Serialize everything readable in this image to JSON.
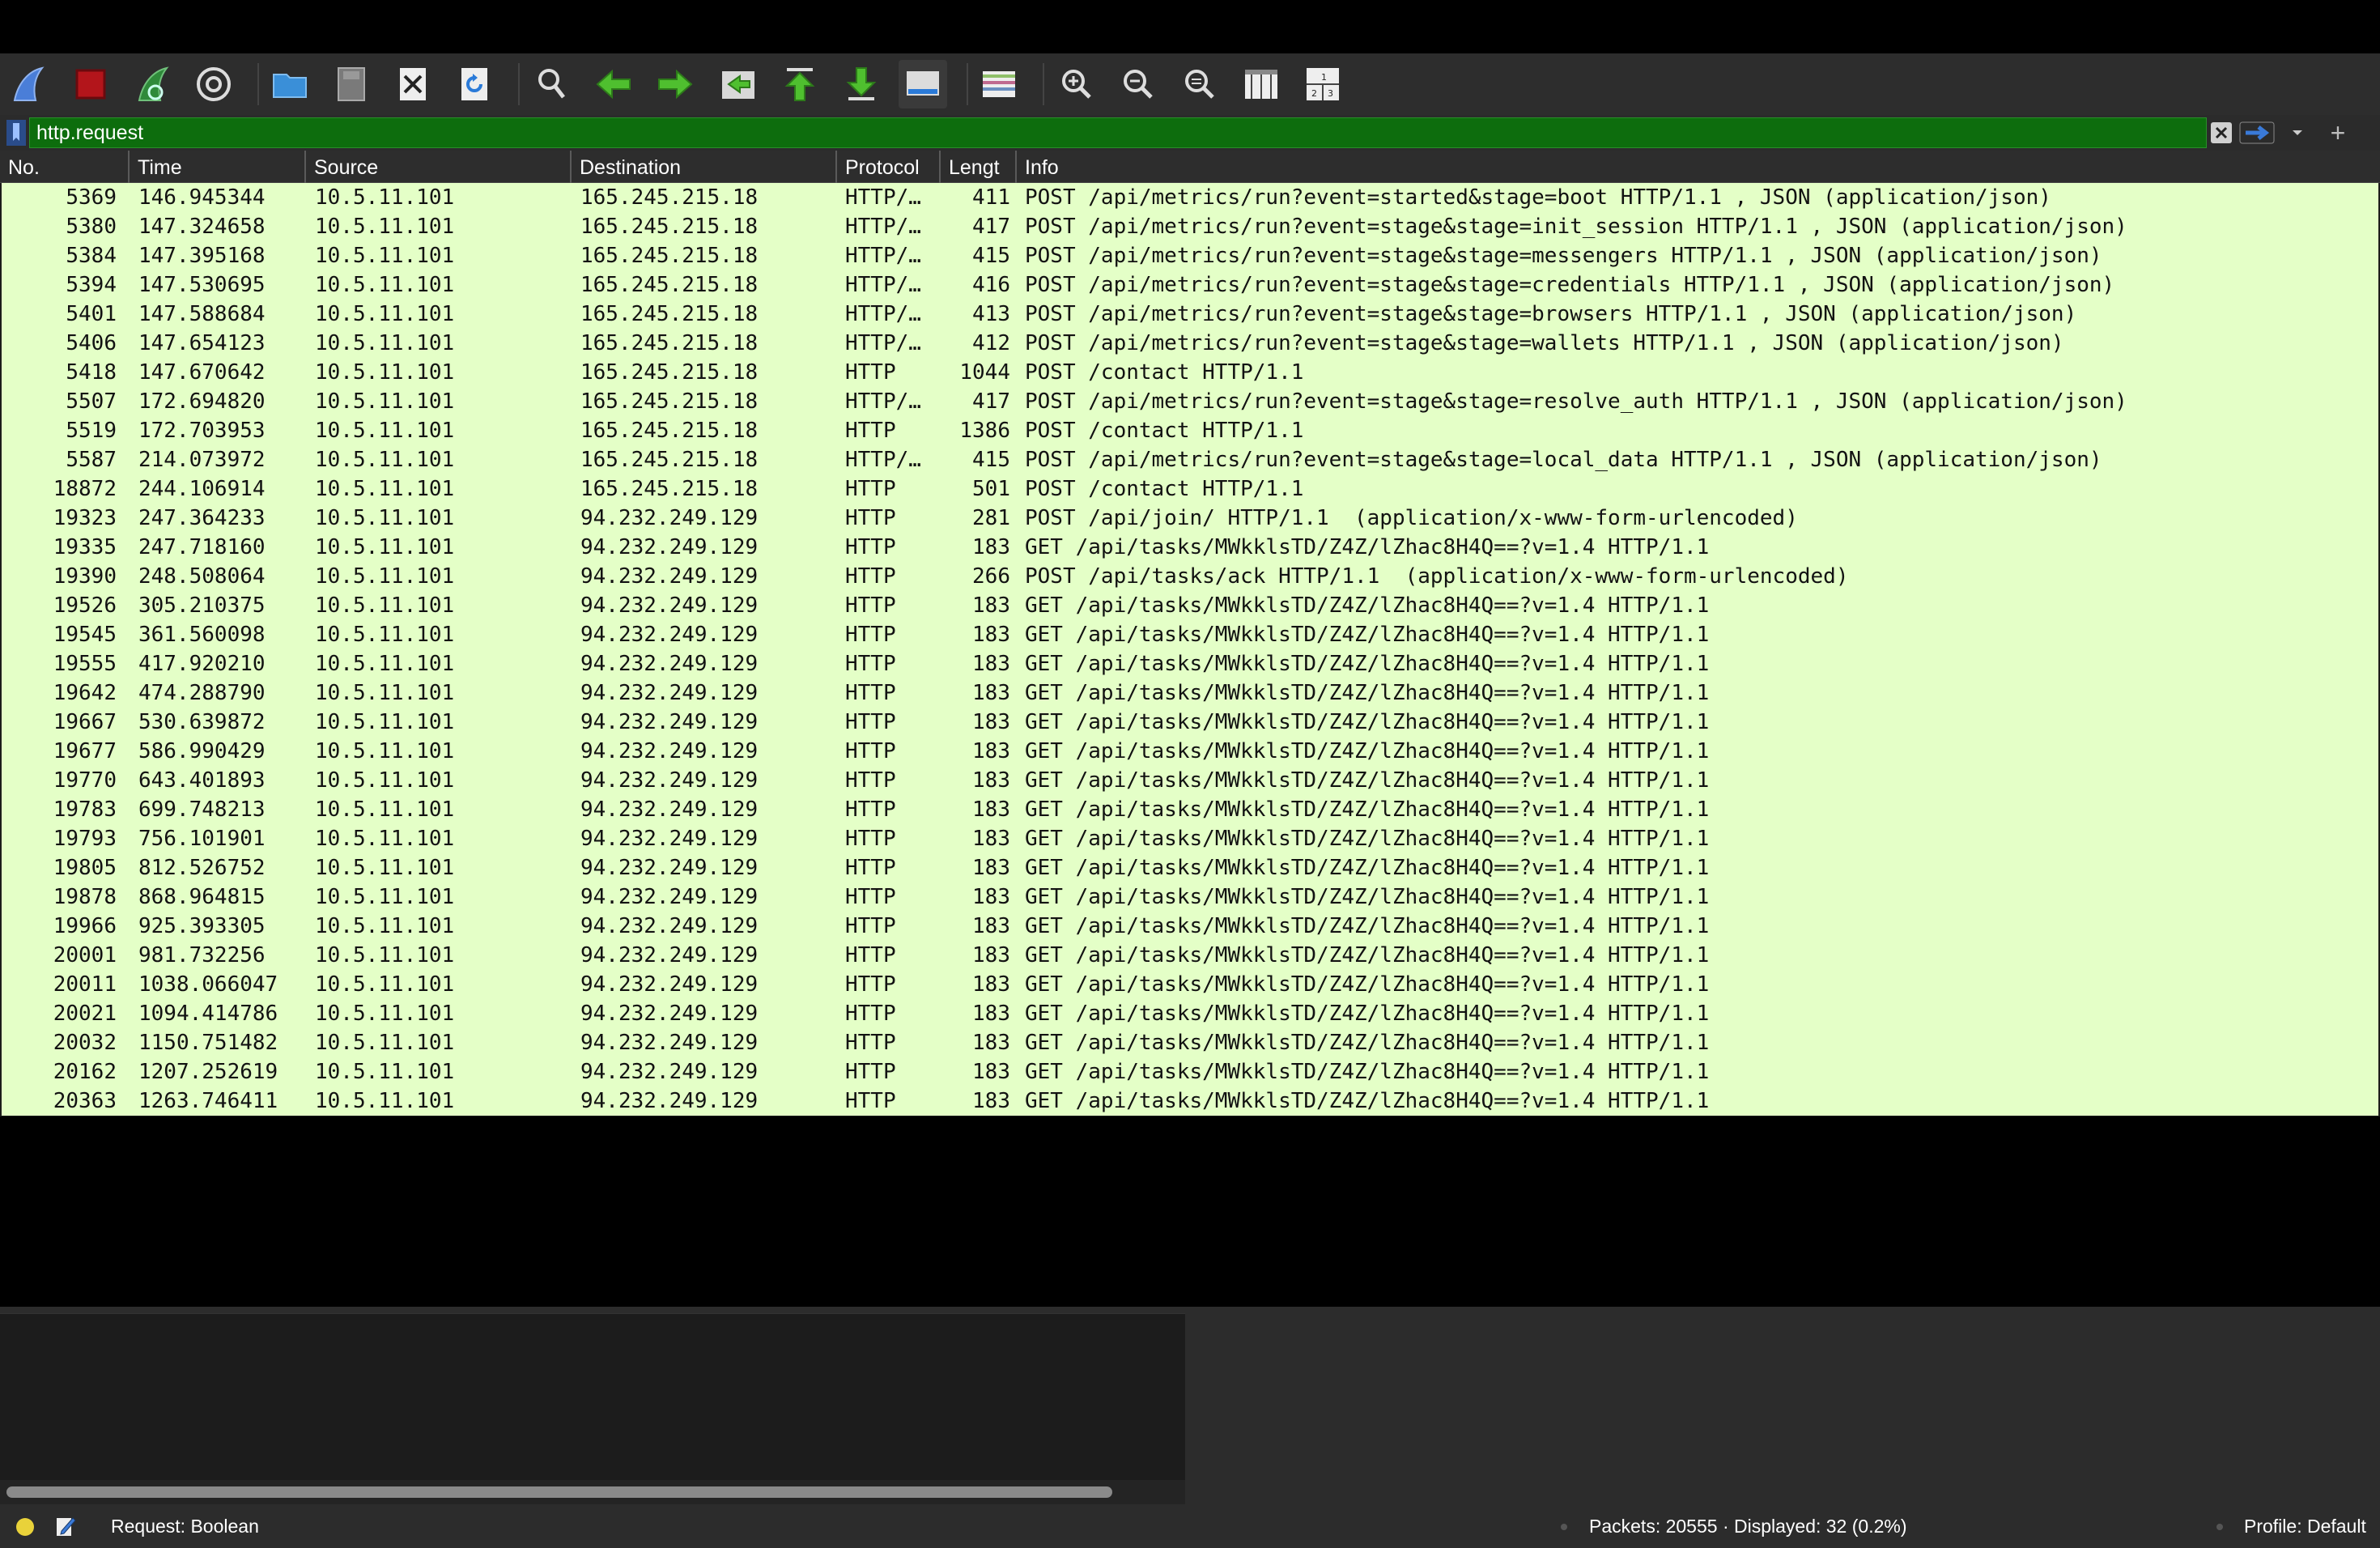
{
  "filter": {
    "value": "http.request"
  },
  "columns": {
    "no": "No.",
    "time": "Time",
    "source": "Source",
    "destination": "Destination",
    "protocol": "Protocol",
    "length": "Lengt",
    "info": "Info"
  },
  "packets": [
    {
      "no": "5369",
      "time": "146.945344",
      "src": "10.5.11.101",
      "dst": "165.245.215.18",
      "proto": "HTTP/…",
      "len": "411",
      "info": "POST /api/metrics/run?event=started&stage=boot HTTP/1.1 , JSON (application/json)"
    },
    {
      "no": "5380",
      "time": "147.324658",
      "src": "10.5.11.101",
      "dst": "165.245.215.18",
      "proto": "HTTP/…",
      "len": "417",
      "info": "POST /api/metrics/run?event=stage&stage=init_session HTTP/1.1 , JSON (application/json)"
    },
    {
      "no": "5384",
      "time": "147.395168",
      "src": "10.5.11.101",
      "dst": "165.245.215.18",
      "proto": "HTTP/…",
      "len": "415",
      "info": "POST /api/metrics/run?event=stage&stage=messengers HTTP/1.1 , JSON (application/json)"
    },
    {
      "no": "5394",
      "time": "147.530695",
      "src": "10.5.11.101",
      "dst": "165.245.215.18",
      "proto": "HTTP/…",
      "len": "416",
      "info": "POST /api/metrics/run?event=stage&stage=credentials HTTP/1.1 , JSON (application/json)"
    },
    {
      "no": "5401",
      "time": "147.588684",
      "src": "10.5.11.101",
      "dst": "165.245.215.18",
      "proto": "HTTP/…",
      "len": "413",
      "info": "POST /api/metrics/run?event=stage&stage=browsers HTTP/1.1 , JSON (application/json)"
    },
    {
      "no": "5406",
      "time": "147.654123",
      "src": "10.5.11.101",
      "dst": "165.245.215.18",
      "proto": "HTTP/…",
      "len": "412",
      "info": "POST /api/metrics/run?event=stage&stage=wallets HTTP/1.1 , JSON (application/json)"
    },
    {
      "no": "5418",
      "time": "147.670642",
      "src": "10.5.11.101",
      "dst": "165.245.215.18",
      "proto": "HTTP",
      "len": "1044",
      "info": "POST /contact HTTP/1.1"
    },
    {
      "no": "5507",
      "time": "172.694820",
      "src": "10.5.11.101",
      "dst": "165.245.215.18",
      "proto": "HTTP/…",
      "len": "417",
      "info": "POST /api/metrics/run?event=stage&stage=resolve_auth HTTP/1.1 , JSON (application/json)"
    },
    {
      "no": "5519",
      "time": "172.703953",
      "src": "10.5.11.101",
      "dst": "165.245.215.18",
      "proto": "HTTP",
      "len": "1386",
      "info": "POST /contact HTTP/1.1"
    },
    {
      "no": "5587",
      "time": "214.073972",
      "src": "10.5.11.101",
      "dst": "165.245.215.18",
      "proto": "HTTP/…",
      "len": "415",
      "info": "POST /api/metrics/run?event=stage&stage=local_data HTTP/1.1 , JSON (application/json)"
    },
    {
      "no": "18872",
      "time": "244.106914",
      "src": "10.5.11.101",
      "dst": "165.245.215.18",
      "proto": "HTTP",
      "len": "501",
      "info": "POST /contact HTTP/1.1"
    },
    {
      "no": "19323",
      "time": "247.364233",
      "src": "10.5.11.101",
      "dst": "94.232.249.129",
      "proto": "HTTP",
      "len": "281",
      "info": "POST /api/join/ HTTP/1.1  (application/x-www-form-urlencoded)"
    },
    {
      "no": "19335",
      "time": "247.718160",
      "src": "10.5.11.101",
      "dst": "94.232.249.129",
      "proto": "HTTP",
      "len": "183",
      "info": "GET /api/tasks/MWkklsTD/Z4Z/lZhac8H4Q==?v=1.4 HTTP/1.1"
    },
    {
      "no": "19390",
      "time": "248.508064",
      "src": "10.5.11.101",
      "dst": "94.232.249.129",
      "proto": "HTTP",
      "len": "266",
      "info": "POST /api/tasks/ack HTTP/1.1  (application/x-www-form-urlencoded)"
    },
    {
      "no": "19526",
      "time": "305.210375",
      "src": "10.5.11.101",
      "dst": "94.232.249.129",
      "proto": "HTTP",
      "len": "183",
      "info": "GET /api/tasks/MWkklsTD/Z4Z/lZhac8H4Q==?v=1.4 HTTP/1.1"
    },
    {
      "no": "19545",
      "time": "361.560098",
      "src": "10.5.11.101",
      "dst": "94.232.249.129",
      "proto": "HTTP",
      "len": "183",
      "info": "GET /api/tasks/MWkklsTD/Z4Z/lZhac8H4Q==?v=1.4 HTTP/1.1"
    },
    {
      "no": "19555",
      "time": "417.920210",
      "src": "10.5.11.101",
      "dst": "94.232.249.129",
      "proto": "HTTP",
      "len": "183",
      "info": "GET /api/tasks/MWkklsTD/Z4Z/lZhac8H4Q==?v=1.4 HTTP/1.1"
    },
    {
      "no": "19642",
      "time": "474.288790",
      "src": "10.5.11.101",
      "dst": "94.232.249.129",
      "proto": "HTTP",
      "len": "183",
      "info": "GET /api/tasks/MWkklsTD/Z4Z/lZhac8H4Q==?v=1.4 HTTP/1.1"
    },
    {
      "no": "19667",
      "time": "530.639872",
      "src": "10.5.11.101",
      "dst": "94.232.249.129",
      "proto": "HTTP",
      "len": "183",
      "info": "GET /api/tasks/MWkklsTD/Z4Z/lZhac8H4Q==?v=1.4 HTTP/1.1"
    },
    {
      "no": "19677",
      "time": "586.990429",
      "src": "10.5.11.101",
      "dst": "94.232.249.129",
      "proto": "HTTP",
      "len": "183",
      "info": "GET /api/tasks/MWkklsTD/Z4Z/lZhac8H4Q==?v=1.4 HTTP/1.1"
    },
    {
      "no": "19770",
      "time": "643.401893",
      "src": "10.5.11.101",
      "dst": "94.232.249.129",
      "proto": "HTTP",
      "len": "183",
      "info": "GET /api/tasks/MWkklsTD/Z4Z/lZhac8H4Q==?v=1.4 HTTP/1.1"
    },
    {
      "no": "19783",
      "time": "699.748213",
      "src": "10.5.11.101",
      "dst": "94.232.249.129",
      "proto": "HTTP",
      "len": "183",
      "info": "GET /api/tasks/MWkklsTD/Z4Z/lZhac8H4Q==?v=1.4 HTTP/1.1"
    },
    {
      "no": "19793",
      "time": "756.101901",
      "src": "10.5.11.101",
      "dst": "94.232.249.129",
      "proto": "HTTP",
      "len": "183",
      "info": "GET /api/tasks/MWkklsTD/Z4Z/lZhac8H4Q==?v=1.4 HTTP/1.1"
    },
    {
      "no": "19805",
      "time": "812.526752",
      "src": "10.5.11.101",
      "dst": "94.232.249.129",
      "proto": "HTTP",
      "len": "183",
      "info": "GET /api/tasks/MWkklsTD/Z4Z/lZhac8H4Q==?v=1.4 HTTP/1.1"
    },
    {
      "no": "19878",
      "time": "868.964815",
      "src": "10.5.11.101",
      "dst": "94.232.249.129",
      "proto": "HTTP",
      "len": "183",
      "info": "GET /api/tasks/MWkklsTD/Z4Z/lZhac8H4Q==?v=1.4 HTTP/1.1"
    },
    {
      "no": "19966",
      "time": "925.393305",
      "src": "10.5.11.101",
      "dst": "94.232.249.129",
      "proto": "HTTP",
      "len": "183",
      "info": "GET /api/tasks/MWkklsTD/Z4Z/lZhac8H4Q==?v=1.4 HTTP/1.1"
    },
    {
      "no": "20001",
      "time": "981.732256",
      "src": "10.5.11.101",
      "dst": "94.232.249.129",
      "proto": "HTTP",
      "len": "183",
      "info": "GET /api/tasks/MWkklsTD/Z4Z/lZhac8H4Q==?v=1.4 HTTP/1.1"
    },
    {
      "no": "20011",
      "time": "1038.066047",
      "src": "10.5.11.101",
      "dst": "94.232.249.129",
      "proto": "HTTP",
      "len": "183",
      "info": "GET /api/tasks/MWkklsTD/Z4Z/lZhac8H4Q==?v=1.4 HTTP/1.1"
    },
    {
      "no": "20021",
      "time": "1094.414786",
      "src": "10.5.11.101",
      "dst": "94.232.249.129",
      "proto": "HTTP",
      "len": "183",
      "info": "GET /api/tasks/MWkklsTD/Z4Z/lZhac8H4Q==?v=1.4 HTTP/1.1"
    },
    {
      "no": "20032",
      "time": "1150.751482",
      "src": "10.5.11.101",
      "dst": "94.232.249.129",
      "proto": "HTTP",
      "len": "183",
      "info": "GET /api/tasks/MWkklsTD/Z4Z/lZhac8H4Q==?v=1.4 HTTP/1.1"
    },
    {
      "no": "20162",
      "time": "1207.252619",
      "src": "10.5.11.101",
      "dst": "94.232.249.129",
      "proto": "HTTP",
      "len": "183",
      "info": "GET /api/tasks/MWkklsTD/Z4Z/lZhac8H4Q==?v=1.4 HTTP/1.1"
    },
    {
      "no": "20363",
      "time": "1263.746411",
      "src": "10.5.11.101",
      "dst": "94.232.249.129",
      "proto": "HTTP",
      "len": "183",
      "info": "GET /api/tasks/MWkklsTD/Z4Z/lZhac8H4Q==?v=1.4 HTTP/1.1"
    }
  ],
  "status": {
    "expert_info_color": "#e9d23a",
    "field_info": "Request: Boolean",
    "packets_summary": "Packets: 20555 · Displayed: 32 (0.2%)",
    "profile": "Profile: Default"
  },
  "colors": {
    "row_background": "#e4ffc7",
    "filter_valid": "#0d6d0d"
  }
}
